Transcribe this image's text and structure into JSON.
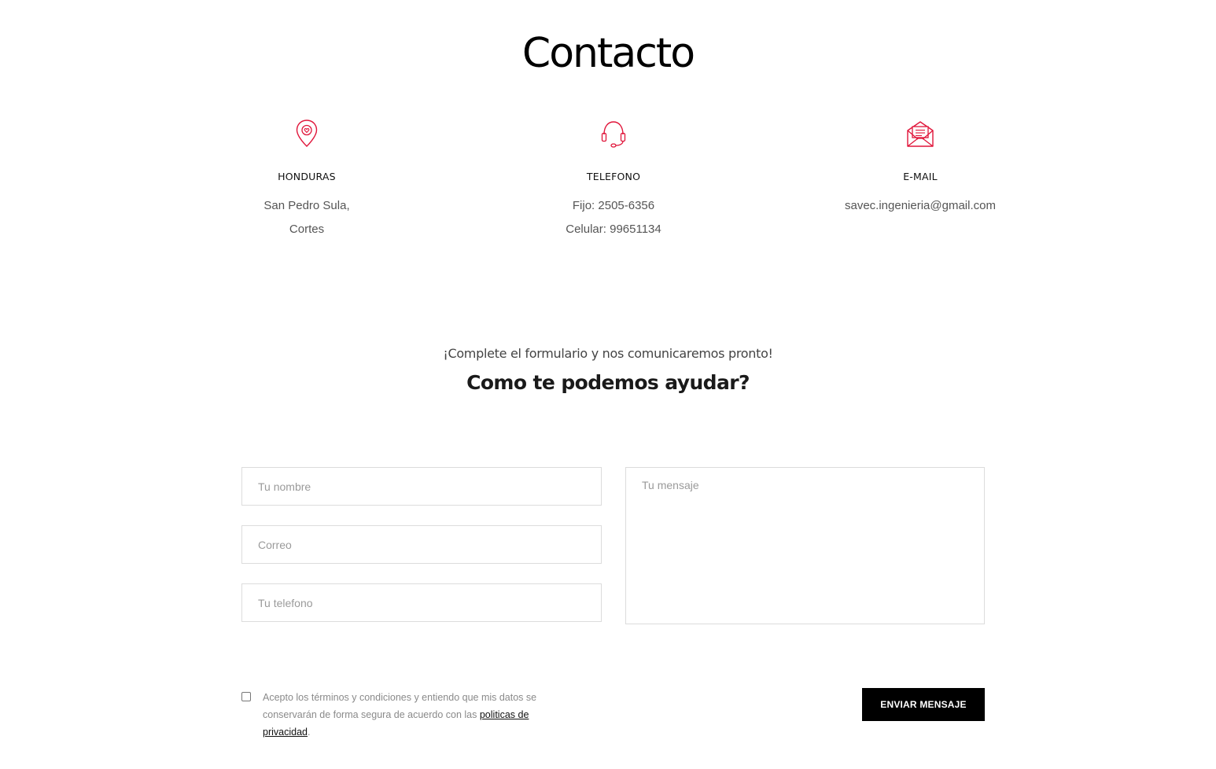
{
  "page": {
    "title": "Contacto"
  },
  "contact": {
    "accent_color": "#e0153a",
    "columns": [
      {
        "icon": "location-pin-icon",
        "heading": "HONDURAS",
        "lines": [
          "San Pedro Sula,",
          "Cortes"
        ]
      },
      {
        "icon": "headset-icon",
        "heading": "TELEFONO",
        "lines": [
          "Fijo: 2505-6356",
          "Celular: 99651134"
        ]
      },
      {
        "icon": "envelope-open-icon",
        "heading": "E-MAIL",
        "lines": [
          "savec.ingenieria@gmail.com"
        ]
      }
    ]
  },
  "form": {
    "intro": "¡Complete el formulario y nos comunicaremos pronto!",
    "heading": "Como te podemos ayudar?",
    "name_placeholder": "Tu nombre",
    "email_placeholder": "Correo",
    "phone_placeholder": "Tu telefono",
    "message_placeholder": "Tu mensaje",
    "consent_text": "Acepto los términos y condiciones y entiendo que mis datos se conservarán de forma segura de acuerdo con las ",
    "consent_link": "politicas de privacidad",
    "consent_suffix": ".",
    "submit_label": "ENVIAR MENSAJE"
  }
}
